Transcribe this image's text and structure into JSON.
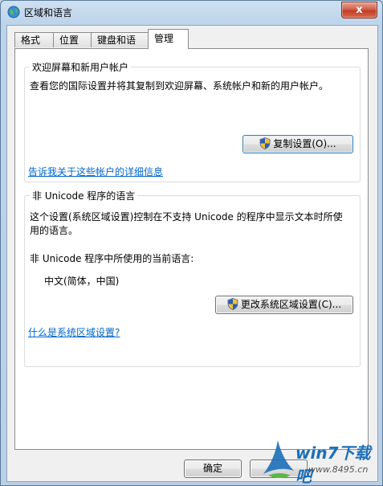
{
  "window": {
    "title": "区域和语言",
    "close_symbol": "x"
  },
  "tabs": [
    {
      "label": "格式"
    },
    {
      "label": "位置"
    },
    {
      "label": "键盘和语言"
    },
    {
      "label": "管理"
    }
  ],
  "welcome_group": {
    "title": "欢迎屏幕和新用户帐户",
    "description": "查看您的国际设置并将其复制到欢迎屏幕、系统帐户和新的用户帐户。",
    "copy_button": "复制设置(O)...",
    "link": "告诉我关于这些帐户的详细信息"
  },
  "unicode_group": {
    "title": "非 Unicode 程序的语言",
    "description_line1": "这个设置(系统区域设置)控制在不支持 Unicode 的程序中显示文本时所使",
    "description_line2": "用的语言。",
    "current_label": "非 Unicode 程序中所使用的当前语言:",
    "current_value": "中文(简体，中国)",
    "change_button": "更改系统区域设置(C)...",
    "link": "什么是系统区域设置?"
  },
  "footer": {
    "ok_button": "确定"
  },
  "watermark": {
    "brand": "win7下载吧",
    "url": "www.8495.cn"
  }
}
